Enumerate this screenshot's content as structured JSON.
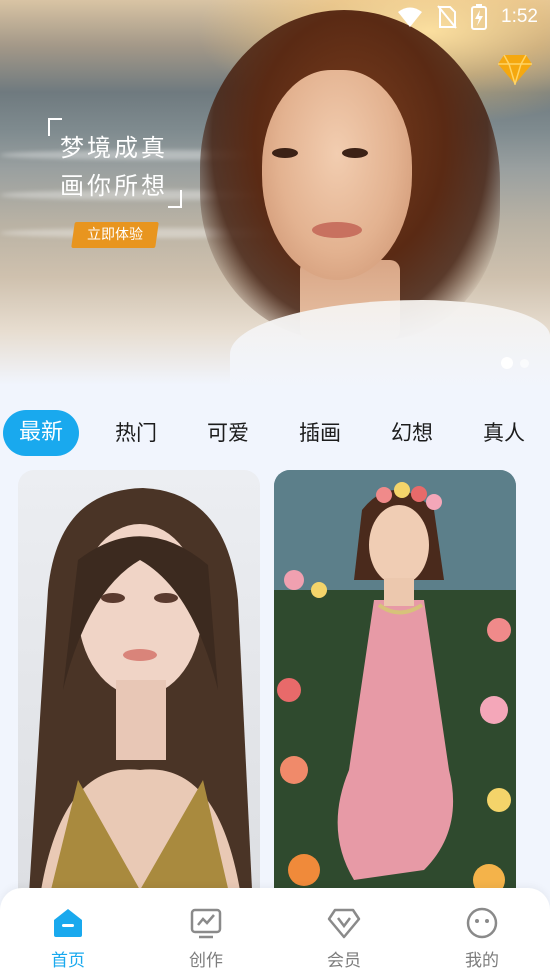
{
  "status_bar": {
    "time": "1:52"
  },
  "banner": {
    "slogan_line1": "梦境成真",
    "slogan_line2": "画你所想",
    "cta_label": "立即体验",
    "page_indicator": {
      "total": 2,
      "current": 1
    }
  },
  "category_tabs": [
    {
      "label": "最新",
      "active": true
    },
    {
      "label": "热门",
      "active": false
    },
    {
      "label": "可爱",
      "active": false
    },
    {
      "label": "插画",
      "active": false
    },
    {
      "label": "幻想",
      "active": false
    },
    {
      "label": "真人",
      "active": false
    }
  ],
  "bottom_nav": [
    {
      "label": "首页",
      "icon": "home-icon",
      "active": true
    },
    {
      "label": "创作",
      "icon": "create-icon",
      "active": false
    },
    {
      "label": "会员",
      "icon": "vip-icon",
      "active": false
    },
    {
      "label": "我的",
      "icon": "profile-icon",
      "active": false
    }
  ],
  "colors": {
    "accent": "#19a9ee",
    "cta": "#e8951f",
    "vip_badge": "#f5a80f"
  }
}
